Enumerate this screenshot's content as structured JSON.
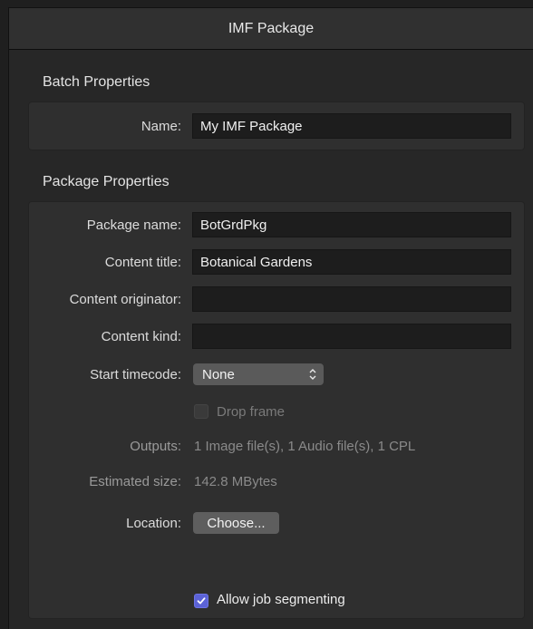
{
  "window": {
    "title": "IMF Package"
  },
  "batch": {
    "section_title": "Batch Properties",
    "name_label": "Name:",
    "name_value": "My IMF Package"
  },
  "package": {
    "section_title": "Package Properties",
    "package_name_label": "Package name:",
    "package_name_value": "BotGrdPkg",
    "content_title_label": "Content title:",
    "content_title_value": "Botanical Gardens",
    "content_originator_label": "Content originator:",
    "content_originator_value": "",
    "content_kind_label": "Content kind:",
    "content_kind_value": "",
    "start_timecode_label": "Start timecode:",
    "start_timecode_value": "None",
    "drop_frame_label": "Drop frame",
    "drop_frame_checked": false,
    "outputs_label": "Outputs:",
    "outputs_value": "1 Image file(s), 1 Audio file(s), 1 CPL",
    "estimated_size_label": "Estimated size:",
    "estimated_size_value": "142.8 MBytes",
    "location_label": "Location:",
    "location_button": "Choose...",
    "allow_segmenting_label": "Allow job segmenting",
    "allow_segmenting_checked": true
  },
  "colors": {
    "accent": "#5b62d6",
    "panel": "#2f2f2f",
    "field": "#1d1d1d"
  }
}
